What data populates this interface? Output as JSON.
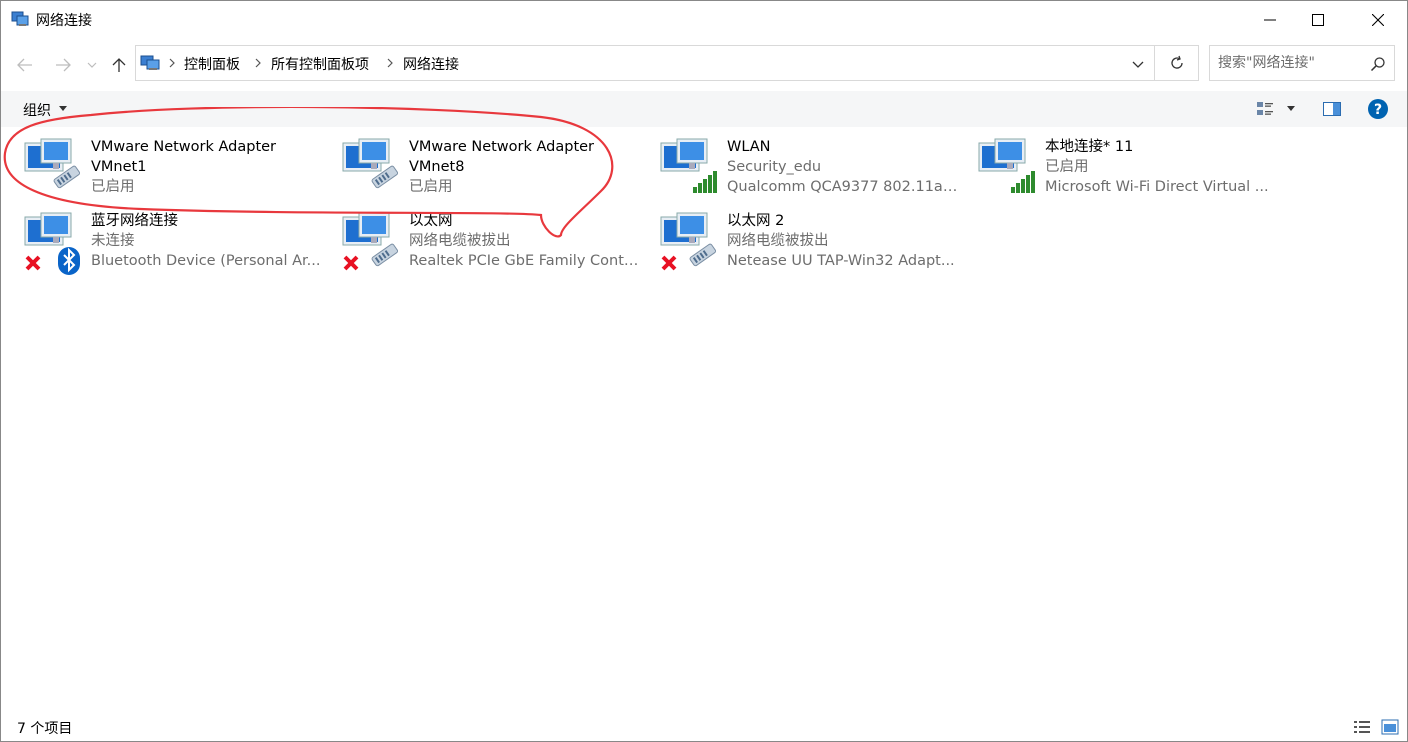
{
  "window": {
    "title": "网络连接"
  },
  "address": {
    "crumbs": [
      "控制面板",
      "所有控制面板项",
      "网络连接"
    ]
  },
  "search": {
    "placeholder": "搜索\"网络连接\""
  },
  "toolbar": {
    "organize_label": "组织"
  },
  "items": [
    {
      "name": "VMware Network Adapter",
      "name2": "VMnet1",
      "status": "已启用",
      "device": "",
      "icon": "wired-adapter-icon",
      "overlay": "none"
    },
    {
      "name": "VMware Network Adapter",
      "name2": "VMnet8",
      "status": "已启用",
      "device": "",
      "icon": "wired-adapter-icon",
      "overlay": "none"
    },
    {
      "name": "WLAN",
      "name2": "",
      "status": "Security_edu",
      "device": "Qualcomm QCA9377 802.11ac...",
      "icon": "wireless-adapter-icon",
      "overlay": "signal"
    },
    {
      "name": "本地连接* 11",
      "name2": "",
      "status": "已启用",
      "device": "Microsoft Wi-Fi Direct Virtual ...",
      "icon": "wireless-adapter-icon",
      "overlay": "signal"
    },
    {
      "name": "蓝牙网络连接",
      "name2": "",
      "status": "未连接",
      "device": "Bluetooth Device (Personal Ar...",
      "icon": "bluetooth-adapter-icon",
      "overlay": "bluetooth-disconnected"
    },
    {
      "name": "以太网",
      "name2": "",
      "status": "网络电缆被拔出",
      "device": "Realtek PCIe GbE Family Contr...",
      "icon": "ethernet-adapter-icon",
      "overlay": "disconnected"
    },
    {
      "name": "以太网 2",
      "name2": "",
      "status": "网络电缆被拔出",
      "device": "Netease UU TAP-Win32 Adapt...",
      "icon": "ethernet-adapter-icon",
      "overlay": "disconnected"
    }
  ],
  "statusbar": {
    "count": "7 个项目"
  },
  "colors": {
    "annotation": "#e8383d",
    "accent": "#0063b1",
    "signal": "#2e8b2e",
    "error": "#e81123"
  }
}
